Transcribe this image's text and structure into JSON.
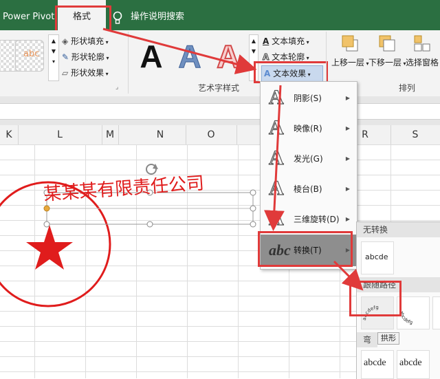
{
  "tabs": {
    "power_pivot": "Power Pivot",
    "format": "格式",
    "search": "操作说明搜索"
  },
  "shape_styles": {
    "fill": "形状填充",
    "outline": "形状轮廓",
    "effects": "形状效果",
    "preview_text": "abc"
  },
  "wordart": {
    "sample_letter": "A",
    "text_fill": "文本填充",
    "text_outline": "文本轮廓",
    "text_effects": "文本效果",
    "group_label": "艺术字样式"
  },
  "arrange": {
    "bring_forward": "上移一层",
    "send_backward": "下移一层",
    "selection_pane": "选择窗格",
    "group_label": "排列"
  },
  "columns": [
    "K",
    "L",
    "M",
    "N",
    "O",
    "R",
    "S"
  ],
  "sheet": {
    "company_text": "某某某有限责任公司"
  },
  "effects_menu": {
    "items": [
      {
        "label": "阴影(S)",
        "glyph": "A"
      },
      {
        "label": "映像(R)",
        "glyph": "A"
      },
      {
        "label": "发光(G)",
        "glyph": "A"
      },
      {
        "label": "棱台(B)",
        "glyph": "A"
      },
      {
        "label": "三维旋转(D)",
        "glyph": "A"
      },
      {
        "label": "转换(T)",
        "glyph": "abc"
      }
    ]
  },
  "transform_panel": {
    "no_transform": "无转换",
    "follow_path": "跟随路径",
    "warp": "弯曲",
    "sample": "abcde",
    "arc_text": "abcdefg",
    "tooltip": "拱形"
  },
  "colors": {
    "excel_green": "#2b6f41",
    "highlight_red": "#e03a3a",
    "stamp_red": "#e01c1c"
  }
}
